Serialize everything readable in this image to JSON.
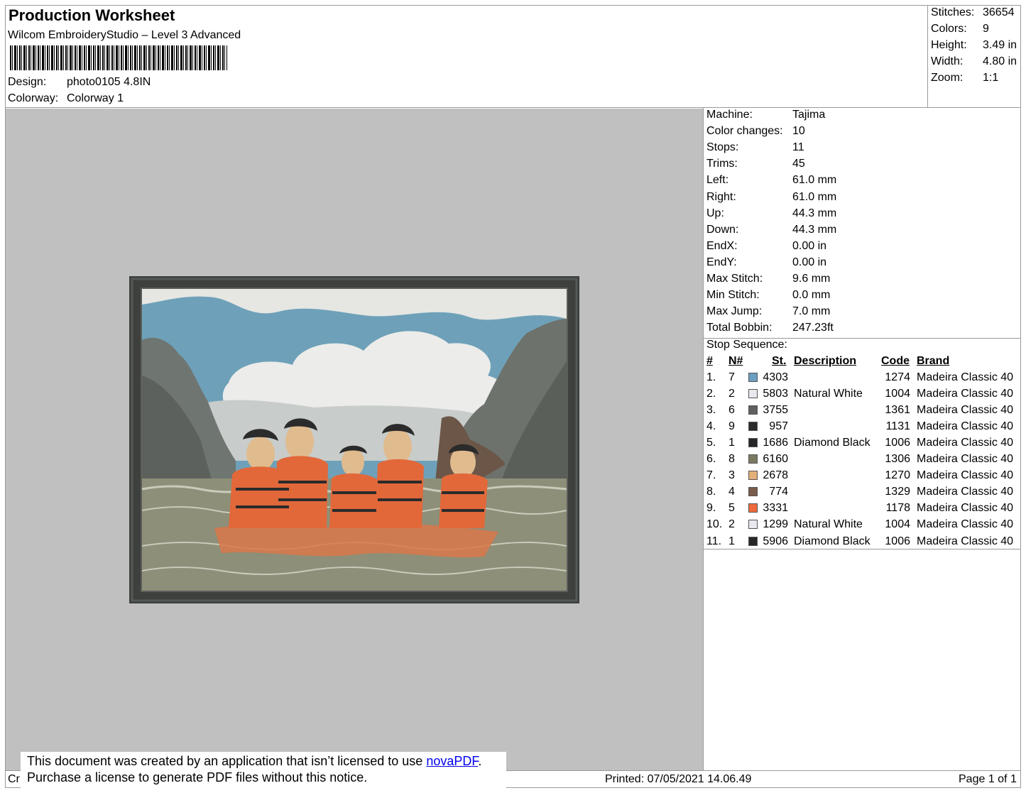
{
  "header": {
    "title": "Production Worksheet",
    "subtitle": "Wilcom EmbroideryStudio – Level 3 Advanced",
    "design_label": "Design:",
    "design_value": "photo0105 4.8IN",
    "colorway_label": "Colorway:",
    "colorway_value": "Colorway 1"
  },
  "stats": [
    {
      "label": "Stitches:",
      "value": "36654"
    },
    {
      "label": "Colors:",
      "value": "9"
    },
    {
      "label": "Height:",
      "value": "3.49 in"
    },
    {
      "label": "Width:",
      "value": "4.80 in"
    },
    {
      "label": "Zoom:",
      "value": "1:1"
    }
  ],
  "machine_info": [
    {
      "label": "Machine:",
      "value": "Tajima"
    },
    {
      "label": "Color changes:",
      "value": "10"
    },
    {
      "label": "Stops:",
      "value": "11"
    },
    {
      "label": "Trims:",
      "value": "45"
    },
    {
      "label": "Left:",
      "value": "61.0 mm"
    },
    {
      "label": "Right:",
      "value": "61.0 mm"
    },
    {
      "label": "Up:",
      "value": "44.3 mm"
    },
    {
      "label": "Down:",
      "value": "44.3 mm"
    },
    {
      "label": "EndX:",
      "value": "0.00 in"
    },
    {
      "label": "EndY:",
      "value": "0.00 in"
    },
    {
      "label": "Max Stitch:",
      "value": "9.6 mm"
    },
    {
      "label": "Min Stitch:",
      "value": "0.0 mm"
    },
    {
      "label": "Max Jump:",
      "value": "7.0 mm"
    },
    {
      "label": "Total Bobbin:",
      "value": "247.23ft"
    }
  ],
  "stop_sequence": {
    "label": "Stop Sequence:",
    "headers": {
      "num": "#",
      "n": "N#",
      "st": "St.",
      "desc": "Description",
      "code": "Code",
      "brand": "Brand"
    },
    "rows": [
      {
        "num": "1.",
        "n": "7",
        "color": "#6b9fc2",
        "st": "4303",
        "desc": "",
        "code": "1274",
        "brand": "Madeira Classic 40"
      },
      {
        "num": "2.",
        "n": "2",
        "color": "#e8e8ee",
        "st": "5803",
        "desc": "Natural White",
        "code": "1004",
        "brand": "Madeira Classic 40"
      },
      {
        "num": "3.",
        "n": "6",
        "color": "#5f5f5f",
        "st": "3755",
        "desc": "",
        "code": "1361",
        "brand": "Madeira Classic 40"
      },
      {
        "num": "4.",
        "n": "9",
        "color": "#2c2c2c",
        "st": "957",
        "desc": "",
        "code": "1131",
        "brand": "Madeira Classic 40"
      },
      {
        "num": "5.",
        "n": "1",
        "color": "#272727",
        "st": "1686",
        "desc": "Diamond Black",
        "code": "1006",
        "brand": "Madeira Classic 40"
      },
      {
        "num": "6.",
        "n": "8",
        "color": "#7a7a62",
        "st": "6160",
        "desc": "",
        "code": "1306",
        "brand": "Madeira Classic 40"
      },
      {
        "num": "7.",
        "n": "3",
        "color": "#e3b07a",
        "st": "2678",
        "desc": "",
        "code": "1270",
        "brand": "Madeira Classic 40"
      },
      {
        "num": "8.",
        "n": "4",
        "color": "#7a5c4c",
        "st": "774",
        "desc": "",
        "code": "1329",
        "brand": "Madeira Classic 40"
      },
      {
        "num": "9.",
        "n": "5",
        "color": "#ee6a3c",
        "st": "3331",
        "desc": "",
        "code": "1178",
        "brand": "Madeira Classic 40"
      },
      {
        "num": "10.",
        "n": "2",
        "color": "#e8e8ee",
        "st": "1299",
        "desc": "Natural White",
        "code": "1004",
        "brand": "Madeira Classic 40"
      },
      {
        "num": "11.",
        "n": "1",
        "color": "#272727",
        "st": "5906",
        "desc": "Diamond Black",
        "code": "1006",
        "brand": "Madeira Classic 40"
      }
    ]
  },
  "footer": {
    "left_fragment": "Cr",
    "printed": "Printed: 07/05/2021 14.06.49",
    "page": "Page 1 of 1"
  },
  "notice": {
    "line1_prefix": "This document was created by an application that isn’t licensed to use ",
    "link": "novaPDF",
    "line1_suffix": ".",
    "line2": "Purchase a license to generate PDF files without this notice."
  }
}
